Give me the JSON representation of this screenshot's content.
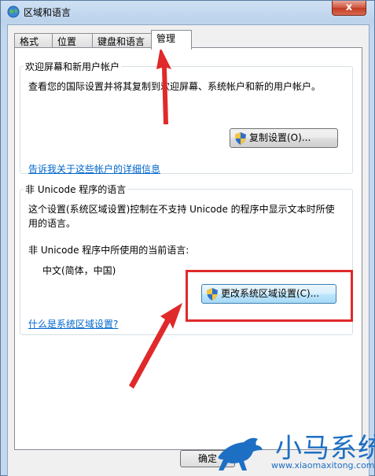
{
  "window": {
    "title": "区域和语言",
    "close_label": "x"
  },
  "tabs": [
    {
      "label": "格式",
      "active": false
    },
    {
      "label": "位置",
      "active": false
    },
    {
      "label": "键盘和语言",
      "active": false
    },
    {
      "label": "管理",
      "active": true
    }
  ],
  "welcome_group": {
    "legend": "欢迎屏幕和新用户帐户",
    "description": "查看您的国际设置并将其复制到欢迎屏幕、系统帐户和新的用户帐户。",
    "copy_button": "复制设置(O)...",
    "details_link": "告诉我关于这些帐户的详细信息"
  },
  "unicode_group": {
    "legend": "非 Unicode 程序的语言",
    "description_line1": "这个设置(系统区域设置)控制在不支持 Unicode 的程序中显示文本时所使",
    "description_line2": "用的语言。",
    "current_label": "非 Unicode 程序中所使用的当前语言:",
    "current_value": "中文(简体，中国)",
    "change_button": "更改系统区域设置(C)...",
    "help_link": "什么是系统区域设置?"
  },
  "footer": {
    "ok_button": "确定"
  },
  "watermark": {
    "title": "小马系统",
    "url": "www.xiaomaxitong.com"
  },
  "colors": {
    "annotation_red": "#e0292a",
    "link_blue": "#0066cc",
    "watermark_blue": "#1d6fc4"
  }
}
